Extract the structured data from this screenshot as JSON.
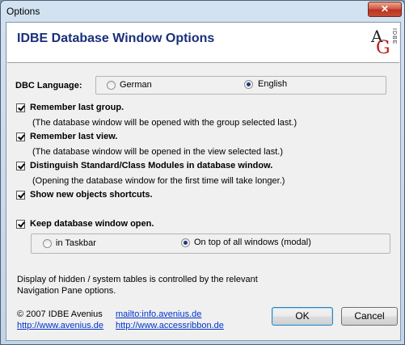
{
  "window": {
    "title": "Options",
    "close_glyph": "✕"
  },
  "header": {
    "title": "IDBE Database Window Options",
    "logo": {
      "letter_a": "A",
      "letter_g": "G",
      "side_text": "IDBE"
    }
  },
  "language": {
    "label": "DBC Language:",
    "options": [
      {
        "label": "German",
        "selected": false
      },
      {
        "label": "English",
        "selected": true
      }
    ]
  },
  "options": [
    {
      "label": "Remember last group.",
      "checked": true,
      "note": "(The database window will be opened with the group selected last.)"
    },
    {
      "label": "Remember last view.",
      "checked": true,
      "note": "(The database window will be opened in the view selected last.)"
    },
    {
      "label": "Distinguish Standard/Class Modules in database window.",
      "checked": true,
      "note": "(Opening the database window for the first time will take longer.)"
    },
    {
      "label": "Show new objects shortcuts.",
      "checked": true,
      "note": ""
    },
    {
      "label": "Keep database window open.",
      "checked": true,
      "note": ""
    }
  ],
  "keep_open": {
    "options": [
      {
        "label": "in Taskbar",
        "selected": false
      },
      {
        "label": "On top of all windows (modal)",
        "selected": true
      }
    ]
  },
  "info_text": "Display of hidden / system tables is controlled by the relevant Navigation Pane options.",
  "footer": {
    "copyright": "© 2007 IDBE Avenius",
    "links": {
      "email": "mailto:info.avenius.de",
      "site1": "http://www.avenius.de",
      "site2": "http://www.accessribbon.de"
    }
  },
  "buttons": {
    "ok": "OK",
    "cancel": "Cancel"
  }
}
